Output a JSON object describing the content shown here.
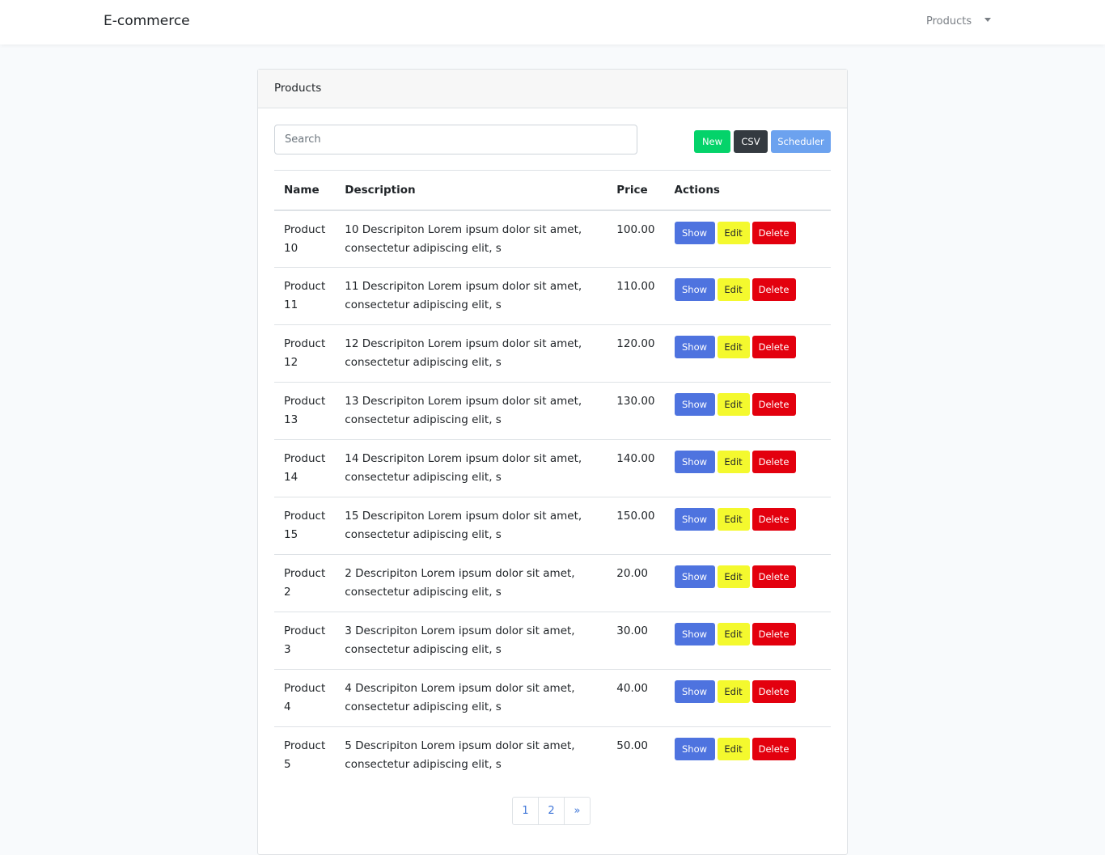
{
  "navbar": {
    "brand": "E-commerce",
    "dropdown_label": "Products"
  },
  "card": {
    "title": "Products"
  },
  "toolbar": {
    "search_placeholder": "Search",
    "new_label": "New",
    "csv_label": "CSV",
    "scheduler_label": "Scheduler"
  },
  "table": {
    "headers": [
      "Name",
      "Description",
      "Price",
      "Actions"
    ],
    "action_labels": {
      "show": "Show",
      "edit": "Edit",
      "delete": "Delete"
    },
    "rows": [
      {
        "name": "Product 10",
        "description": "10 Descripiton Lorem ipsum dolor sit amet, consectetur adipiscing elit, s",
        "price": "100.00"
      },
      {
        "name": "Product 11",
        "description": "11 Descripiton Lorem ipsum dolor sit amet, consectetur adipiscing elit, s",
        "price": "110.00"
      },
      {
        "name": "Product 12",
        "description": "12 Descripiton Lorem ipsum dolor sit amet, consectetur adipiscing elit, s",
        "price": "120.00"
      },
      {
        "name": "Product 13",
        "description": "13 Descripiton Lorem ipsum dolor sit amet, consectetur adipiscing elit, s",
        "price": "130.00"
      },
      {
        "name": "Product 14",
        "description": "14 Descripiton Lorem ipsum dolor sit amet, consectetur adipiscing elit, s",
        "price": "140.00"
      },
      {
        "name": "Product 15",
        "description": "15 Descripiton Lorem ipsum dolor sit amet, consectetur adipiscing elit, s",
        "price": "150.00"
      },
      {
        "name": "Product 2",
        "description": "2 Descripiton Lorem ipsum dolor sit amet, consectetur adipiscing elit, s",
        "price": "20.00"
      },
      {
        "name": "Product 3",
        "description": "3 Descripiton Lorem ipsum dolor sit amet, consectetur adipiscing elit, s",
        "price": "30.00"
      },
      {
        "name": "Product 4",
        "description": "4 Descripiton Lorem ipsum dolor sit amet, consectetur adipiscing elit, s",
        "price": "40.00"
      },
      {
        "name": "Product 5",
        "description": "5 Descripiton Lorem ipsum dolor sit amet, consectetur adipiscing elit, s",
        "price": "50.00"
      }
    ]
  },
  "pagination": {
    "pages": [
      "1",
      "2"
    ],
    "next": "»"
  },
  "colors": {
    "new": "#04d36a",
    "csv": "#343a40",
    "scheduler": "#6ca2ef",
    "show": "#4e73df",
    "edit": "#f4f92e",
    "delete": "#e3000e",
    "link": "#3f76d8"
  },
  "icons": {
    "dropdown": "caret-down-icon"
  }
}
